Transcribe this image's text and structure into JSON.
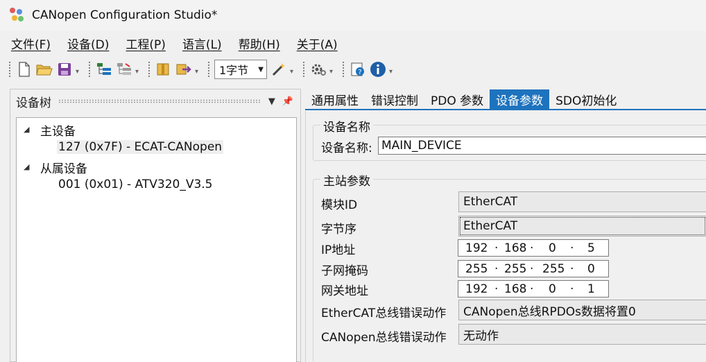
{
  "window": {
    "title": "CANopen Configuration Studio*"
  },
  "menu": [
    {
      "label": "文件(F)"
    },
    {
      "label": "设备(D)"
    },
    {
      "label": "工程(P)"
    },
    {
      "label": "语言(L)"
    },
    {
      "label": "帮助(H)"
    },
    {
      "label": "关于(A)"
    }
  ],
  "toolbar": {
    "byte_size": "1字节",
    "icons": [
      "new-file-icon",
      "open-folder-icon",
      "save-icon",
      "add-tree-icon",
      "remove-tree-icon",
      "import-icon",
      "export-icon",
      "wand-icon",
      "settings-icon",
      "help-icon",
      "info-icon"
    ]
  },
  "left_panel": {
    "title": "设备树",
    "tree": {
      "master_label": "主设备",
      "master_child": "127 (0x7F)  -  ECAT-CANopen",
      "slave_label": "从属设备",
      "slave_child": "001 (0x01)  -  ATV320_V3.5"
    }
  },
  "tabs": [
    {
      "label": "通用属性"
    },
    {
      "label": "错误控制"
    },
    {
      "label": "PDO 参数"
    },
    {
      "label": "设备参数",
      "active": true
    },
    {
      "label": "SDO初始化"
    }
  ],
  "device_name_group": {
    "legend": "设备名称",
    "label": "设备名称:",
    "value": "MAIN_DEVICE"
  },
  "master_params": {
    "legend": "主站参数",
    "module_id": {
      "label": "模块ID",
      "value": "EtherCAT"
    },
    "byte_order": {
      "label": "字节序",
      "value": "EtherCAT"
    },
    "ip": {
      "label": "IP地址",
      "octets": [
        "192",
        "168",
        "0",
        "5"
      ]
    },
    "subnet": {
      "label": "子网掩码",
      "octets": [
        "255",
        "255",
        "255",
        "0"
      ]
    },
    "gateway": {
      "label": "网关地址",
      "octets": [
        "192",
        "168",
        "0",
        "1"
      ]
    },
    "ethercat_error": {
      "label": "EtherCAT总线错误动作",
      "value": "CANopen总线RPDOs数据将置0"
    },
    "canopen_error": {
      "label": "CANopen总线错误动作",
      "value": "无动作"
    }
  }
}
